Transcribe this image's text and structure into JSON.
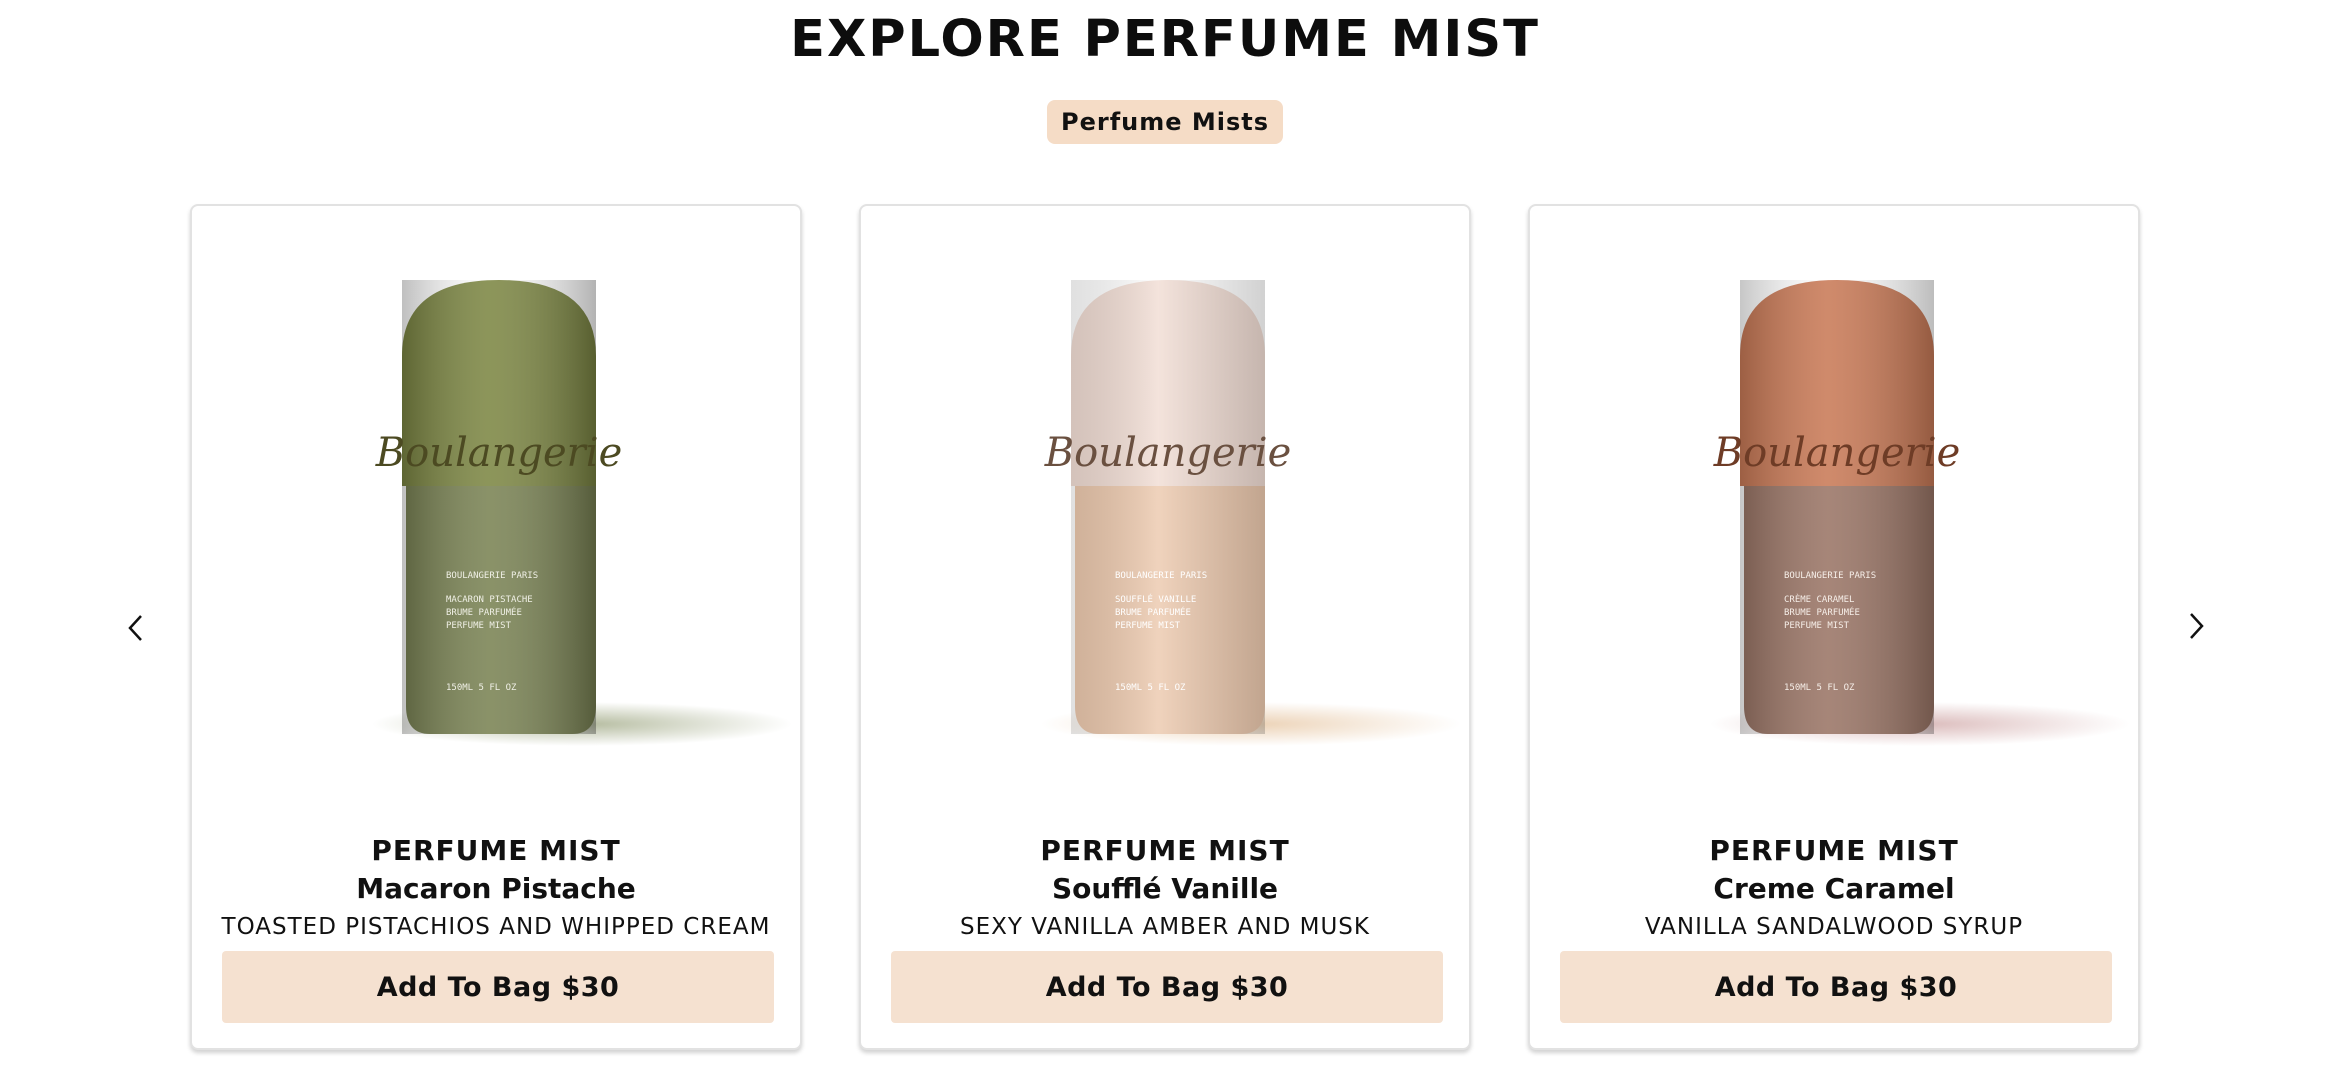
{
  "header": {
    "title": "EXPLORE PERFUME MIST"
  },
  "filters": [
    {
      "label": "Perfume Mists",
      "active": true
    }
  ],
  "carousel": {
    "prev_icon": "chevron-left-icon",
    "next_icon": "chevron-right-icon"
  },
  "products": [
    {
      "category": "PERFUME MIST",
      "name": "Macaron Pistache",
      "notes": "TOASTED PISTACHIOS AND WHIPPED CREAM",
      "button_label": "Add To Bag $30",
      "bottle": {
        "brand": "Boulangerie",
        "label_lines": [
          "BOULANGERIE PARIS",
          "MACARON PISTACHE",
          "BRUME PARFUMÉE",
          "PERFUME MIST"
        ],
        "volume": "150ML 5 FL OZ",
        "cap_color": "#7d8744",
        "body_color": "#7a8354"
      }
    },
    {
      "category": "PERFUME MIST",
      "name": "Soufflé Vanille",
      "notes": "SEXY VANILLA AMBER AND MUSK",
      "button_label": "Add To Bag $30",
      "bottle": {
        "brand": "Boulangerie",
        "label_lines": [
          "BOULANGERIE PARIS",
          "SOUFFLÉ VANILLE",
          "BRUME PARFUMÉE",
          "PERFUME MIST"
        ],
        "volume": "150ML 5 FL OZ",
        "cap_color": "#f1ddd4",
        "body_color": "#ecc9ae"
      }
    },
    {
      "category": "PERFUME MIST",
      "name": "Creme Caramel",
      "notes": "VANILLA SANDALWOOD SYRUP",
      "button_label": "Add To Bag $30",
      "bottle": {
        "brand": "Boulangerie",
        "label_lines": [
          "BOULANGERIE PARIS",
          "CRÈME CARAMEL",
          "BRUME PARFUMÉE",
          "PERFUME MIST"
        ],
        "volume": "150ML 5 FL OZ",
        "cap_color": "#c97a57",
        "body_color": "#9a7566"
      }
    }
  ]
}
